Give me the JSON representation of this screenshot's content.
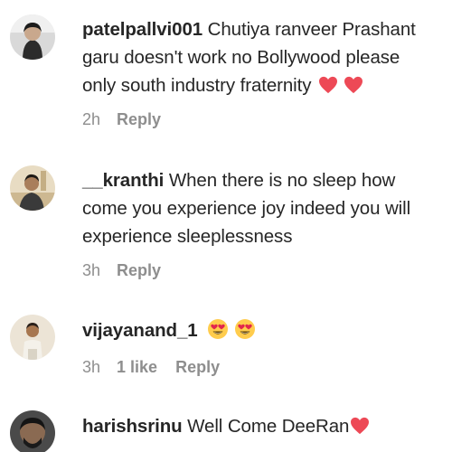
{
  "comments": [
    {
      "username": "patelpallvi001",
      "lines": [
        "Chutiya ranveer Prashant",
        "garu doesn't work no Bollywood please",
        "only south industry fraternity"
      ],
      "trailing_emoji": [
        "red-heart-icon",
        "red-heart-icon"
      ],
      "time": "2h",
      "likes": "",
      "reply_label": "Reply"
    },
    {
      "username": "__kranthi",
      "lines": [
        "When there is no sleep how",
        "come you experience joy indeed you will",
        "experience sleeplessness"
      ],
      "trailing_emoji": [],
      "time": "3h",
      "likes": "",
      "reply_label": "Reply"
    },
    {
      "username": "vijayanand_1",
      "lines": [
        ""
      ],
      "trailing_emoji": [
        "heart-eyes-emoji-icon",
        "heart-eyes-emoji-icon"
      ],
      "time": "3h",
      "likes": "1 like",
      "reply_label": "Reply"
    },
    {
      "username": "harishsrinu",
      "lines": [
        "Well Come DeeRan"
      ],
      "trailing_emoji": [
        "red-heart-icon"
      ],
      "time": "",
      "likes": "",
      "reply_label": ""
    }
  ],
  "colors": {
    "text": "#262626",
    "meta": "#8e8e8e",
    "heart": "#ed4956",
    "emoji_face": "#ffcc4d"
  }
}
